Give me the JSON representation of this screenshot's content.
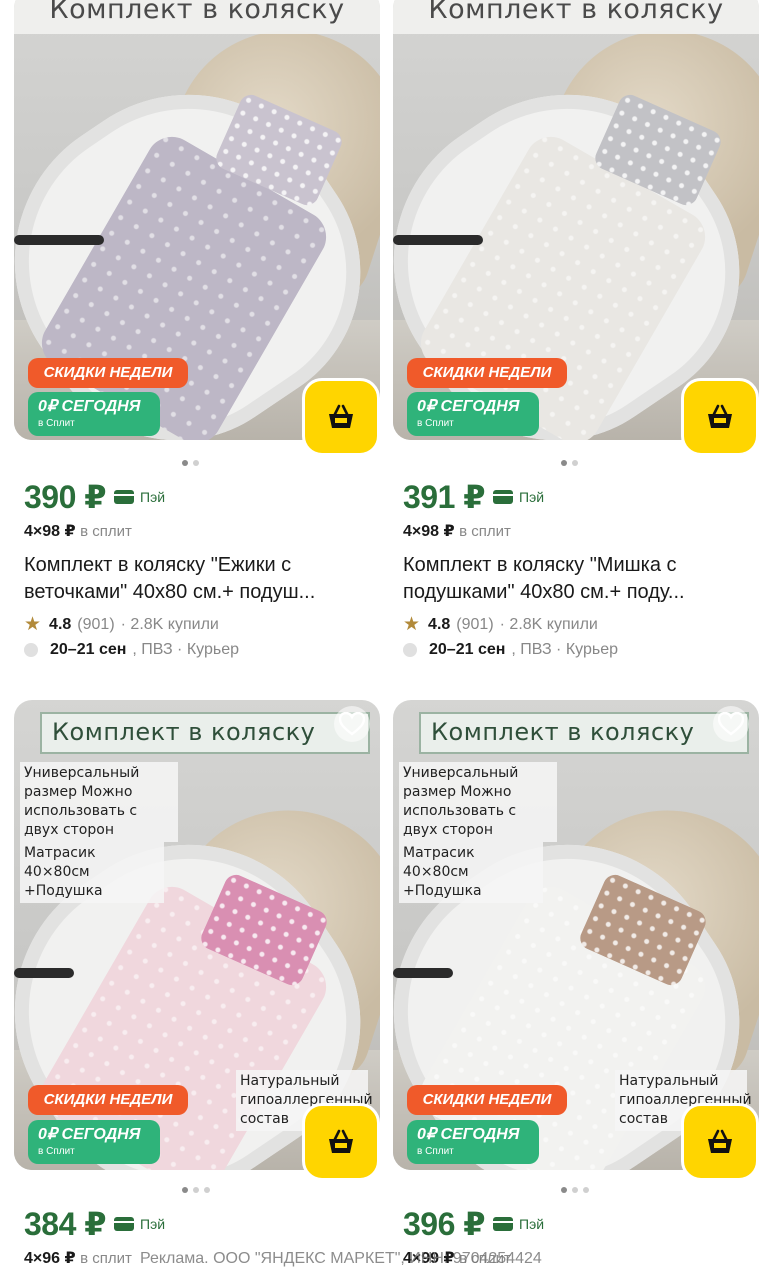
{
  "products": [
    {
      "banner": "Комплект в коляску",
      "sale_badge": "СКИДКИ НЕДЕЛИ",
      "split_badge_line1": "0₽ СЕГОДНЯ",
      "split_badge_line2": "в Сплит",
      "price": "390 ₽",
      "pay_label": "Пэй",
      "split_amount": "4×98 ₽",
      "split_label": "в сплит",
      "title": "Комплект в коляску \"Ежики с веточками\" 40х80 см.+ подуш...",
      "rating": "4.8",
      "reviews": "(901)",
      "bought": "· 2.8K купили",
      "delivery_dates": "20–21 сен",
      "delivery_options": ", ПВЗ · Курьер",
      "fabric_color": "#bdb7c6",
      "pillow_color": "#c9c3cf"
    },
    {
      "banner": "Комплект в коляску",
      "sale_badge": "СКИДКИ НЕДЕЛИ",
      "split_badge_line1": "0₽ СЕГОДНЯ",
      "split_badge_line2": "в Сплит",
      "price": "391 ₽",
      "pay_label": "Пэй",
      "split_amount": "4×98 ₽",
      "split_label": "в сплит",
      "title": "Комплект в коляску \"Мишка с подушками\" 40х80 см.+ поду...",
      "rating": "4.8",
      "reviews": "(901)",
      "bought": "· 2.8K купили",
      "delivery_dates": "20–21 сен",
      "delivery_options": ", ПВЗ · Курьер",
      "fabric_color": "#e9e7e3",
      "pillow_color": "#c2c2c6"
    },
    {
      "banner": "Комплект в коляску",
      "info_1": "Универсальный размер Можно использовать с двух сторон",
      "info_2": "Матрасик 40×80см +Подушка",
      "info_3": "Натуральный гипоаллергенный состав",
      "sale_badge": "СКИДКИ НЕДЕЛИ",
      "split_badge_line1": "0₽ СЕГОДНЯ",
      "split_badge_line2": "в Сплит",
      "price": "384 ₽",
      "pay_label": "Пэй",
      "split_amount": "4×96 ₽",
      "split_label": "в сплит",
      "fabric_color": "#f0d7dd",
      "pillow_color": "#d98fb2"
    },
    {
      "banner": "Комплект в коляску",
      "info_1": "Универсальный размер Можно использовать с двух сторон",
      "info_2": "Матрасик 40×80см +Подушка",
      "info_3": "Натуральный гипоаллергенный состав",
      "sale_badge": "СКИДКИ НЕДЕЛИ",
      "split_badge_line1": "0₽ СЕГОДНЯ",
      "split_badge_line2": "в Сплит",
      "price": "396 ₽",
      "pay_label": "Пэй",
      "split_amount": "4×99 ₽",
      "split_label": "в сплит",
      "fabric_color": "#f2f2f0",
      "pillow_color": "#b89a86"
    }
  ],
  "ad_disclaimer": "Реклама. ООО \"ЯНДЕКС МАРКЕТ\", ИНН: 9704254424",
  "colors": {
    "price_green": "#2a6e3a",
    "sale_orange": "#f05a2a",
    "split_green": "#2fb37a",
    "cart_yellow": "#ffd500",
    "rating_star": "#b28a3a"
  },
  "icons": [
    "heart-icon",
    "basket-icon",
    "star-icon",
    "pay-card-icon"
  ]
}
